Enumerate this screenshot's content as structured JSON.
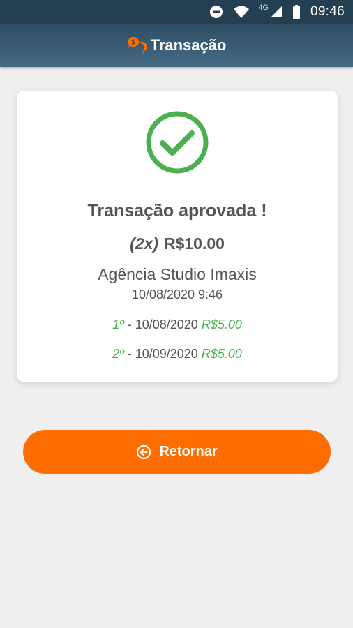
{
  "status_bar": {
    "network": "4G",
    "time": "09:46"
  },
  "app_bar": {
    "title": "Transação",
    "icon": "chat-money-icon"
  },
  "receipt": {
    "headline": "Transação aprovada !",
    "installments_label": "(2x)",
    "total": "R$10.00",
    "merchant": "Agência Studio Imaxis",
    "datetime": "10/08/2020 9:46",
    "installments": [
      {
        "ordinal": "1º",
        "separator": " - 10/08/2020 ",
        "amount": "R$5.00"
      },
      {
        "ordinal": "2º",
        "separator": " - 10/09/2020 ",
        "amount": "R$5.00"
      }
    ]
  },
  "actions": {
    "return_label": "Retornar",
    "return_icon": "arrow-left-circle-icon"
  },
  "colors": {
    "accent": "#ff6d00",
    "success": "#4caf50",
    "header": "#2e4e64"
  }
}
